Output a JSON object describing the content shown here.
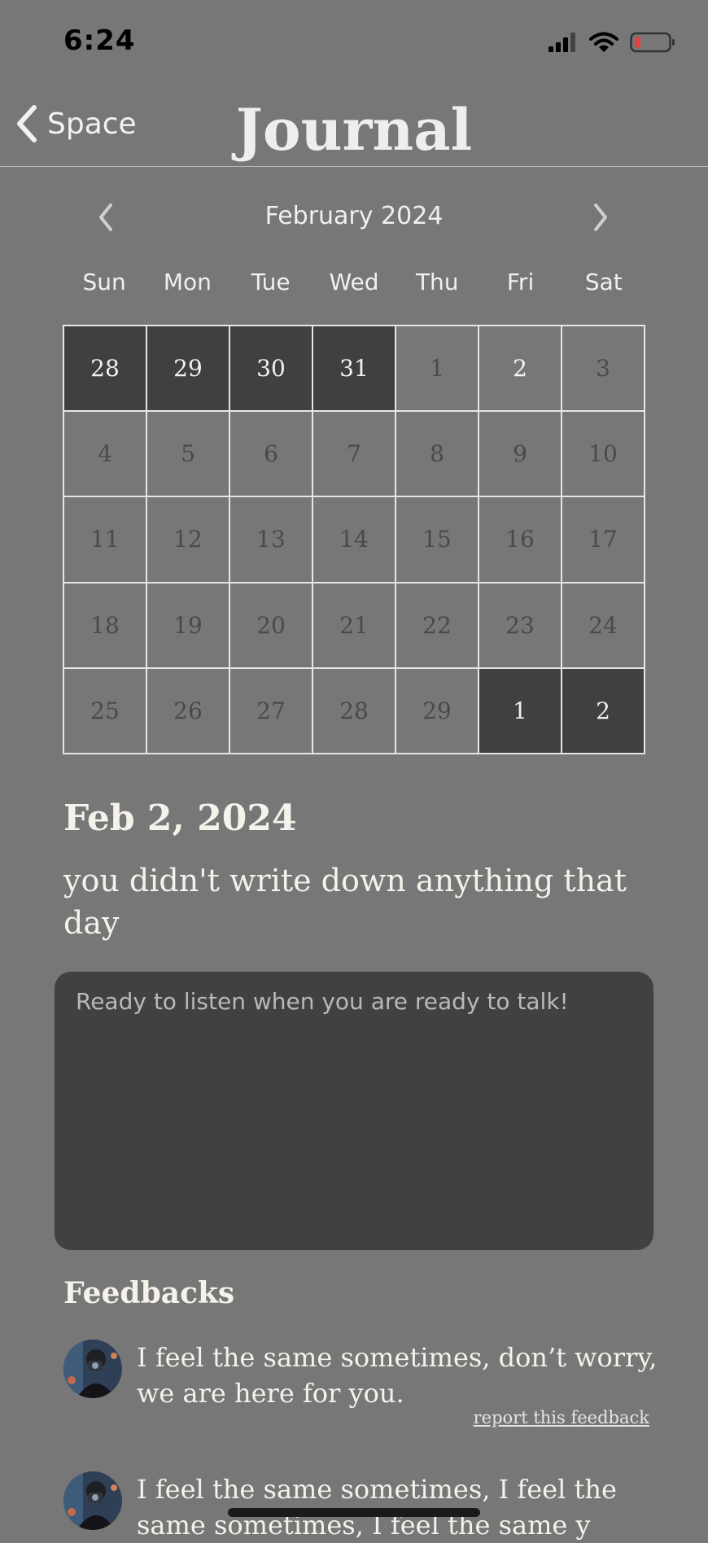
{
  "status_bar": {
    "time": "6:24"
  },
  "nav": {
    "back_label": "Space",
    "title": "Journal"
  },
  "calendar": {
    "month_label": "February 2024",
    "weekdays": [
      "Sun",
      "Mon",
      "Tue",
      "Wed",
      "Thu",
      "Fri",
      "Sat"
    ],
    "days": [
      {
        "label": "28",
        "style": "dark"
      },
      {
        "label": "29",
        "style": "dark"
      },
      {
        "label": "30",
        "style": "dark"
      },
      {
        "label": "31",
        "style": "dark"
      },
      {
        "label": "1",
        "style": "normal"
      },
      {
        "label": "2",
        "style": "bright"
      },
      {
        "label": "3",
        "style": "normal"
      },
      {
        "label": "4",
        "style": "normal"
      },
      {
        "label": "5",
        "style": "normal"
      },
      {
        "label": "6",
        "style": "normal"
      },
      {
        "label": "7",
        "style": "normal"
      },
      {
        "label": "8",
        "style": "normal"
      },
      {
        "label": "9",
        "style": "normal"
      },
      {
        "label": "10",
        "style": "normal"
      },
      {
        "label": "11",
        "style": "normal"
      },
      {
        "label": "12",
        "style": "normal"
      },
      {
        "label": "13",
        "style": "normal"
      },
      {
        "label": "14",
        "style": "normal"
      },
      {
        "label": "15",
        "style": "normal"
      },
      {
        "label": "16",
        "style": "normal"
      },
      {
        "label": "17",
        "style": "normal"
      },
      {
        "label": "18",
        "style": "normal"
      },
      {
        "label": "19",
        "style": "normal"
      },
      {
        "label": "20",
        "style": "normal"
      },
      {
        "label": "21",
        "style": "normal"
      },
      {
        "label": "22",
        "style": "normal"
      },
      {
        "label": "23",
        "style": "normal"
      },
      {
        "label": "24",
        "style": "normal"
      },
      {
        "label": "25",
        "style": "normal"
      },
      {
        "label": "26",
        "style": "normal"
      },
      {
        "label": "27",
        "style": "normal"
      },
      {
        "label": "28",
        "style": "normal"
      },
      {
        "label": "29",
        "style": "normal"
      },
      {
        "label": "1",
        "style": "dark"
      },
      {
        "label": "2",
        "style": "dark"
      }
    ]
  },
  "entry": {
    "date": "Feb 2, 2024",
    "message": "you didn't write down anything that day",
    "input_placeholder": "Ready to listen when you are ready to talk!"
  },
  "feedbacks": {
    "title": "Feedbacks",
    "items": [
      {
        "text": "I feel the same sometimes, don’t worry, we are here for you.",
        "report_label": "report this feedback"
      },
      {
        "text": "I feel the same sometimes, I feel the same sometimes, I feel the same y"
      }
    ]
  },
  "colors": {
    "background": "#777777",
    "dark_cell": "#414040",
    "battery_low": "#e0443c"
  }
}
